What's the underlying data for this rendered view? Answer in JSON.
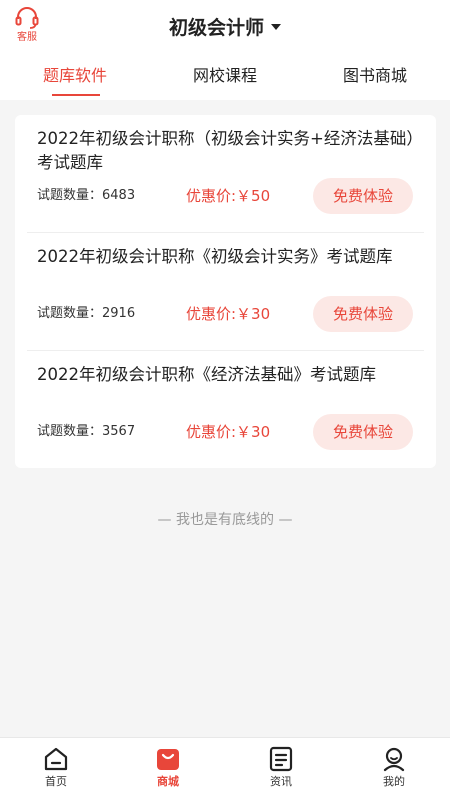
{
  "header": {
    "customer_service_label": "客服",
    "title": "初级会计师"
  },
  "tabs": [
    {
      "label": "题库软件",
      "active": true
    },
    {
      "label": "网校课程",
      "active": false
    },
    {
      "label": "图书商城",
      "active": false
    }
  ],
  "items": [
    {
      "title": "2022年初级会计职称（初级会计实务+经济法基础）考试题库",
      "count_text": "试题数量：6483",
      "price_text": "优惠价:￥50",
      "button_label": "免费体验"
    },
    {
      "title": "2022年初级会计职称《初级会计实务》考试题库",
      "count_text": "试题数量：2916",
      "price_text": "优惠价:￥30",
      "button_label": "免费体验"
    },
    {
      "title": "2022年初级会计职称《经济法基础》考试题库",
      "count_text": "试题数量：3567",
      "price_text": "优惠价:￥30",
      "button_label": "免费体验"
    }
  ],
  "end_text": "— 我也是有底线的 —",
  "bottom_nav": [
    {
      "label": "首页",
      "icon": "home-icon",
      "active": false
    },
    {
      "label": "商城",
      "icon": "shopping-bag-icon",
      "active": true
    },
    {
      "label": "资讯",
      "icon": "news-icon",
      "active": false
    },
    {
      "label": "我的",
      "icon": "user-icon",
      "active": false
    }
  ],
  "colors": {
    "accent": "#e8463a",
    "button_bg": "#fce8e5",
    "page_bg": "#f5f5f5"
  }
}
